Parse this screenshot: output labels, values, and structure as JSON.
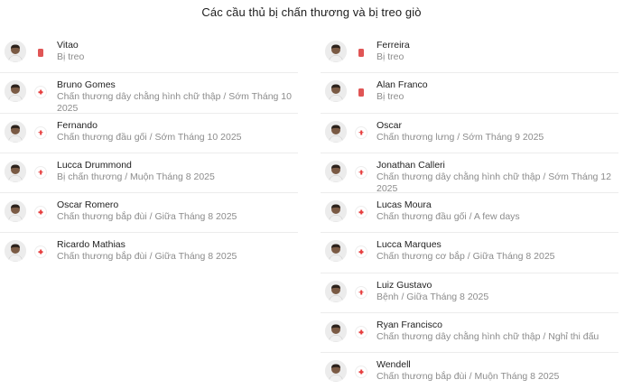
{
  "title": "Các cầu thủ bị chấn thương và bị treo giò",
  "colors": {
    "card": "#e05555",
    "injury_cross": "#e63e3e"
  },
  "left_column": [
    {
      "name": "Vitao",
      "status_icon": "red-card-icon",
      "detail": "Bị treo"
    },
    {
      "name": "Bruno Gomes",
      "status_icon": "injury-cross-icon",
      "detail": "Chấn thương dây chằng hình chữ thập / Sớm Tháng 10 2025"
    },
    {
      "name": "Fernando",
      "status_icon": "injury-cross-icon",
      "detail": "Chấn thương đầu gối / Sớm Tháng 10 2025"
    },
    {
      "name": "Lucca Drummond",
      "status_icon": "injury-cross-icon",
      "detail": "Bị chấn thương / Muộn Tháng 8 2025"
    },
    {
      "name": "Oscar Romero",
      "status_icon": "injury-cross-icon",
      "detail": "Chấn thương bắp đùi / Giữa Tháng 8 2025"
    },
    {
      "name": "Ricardo Mathias",
      "status_icon": "injury-cross-icon",
      "detail": "Chấn thương bắp đùi / Giữa Tháng 8 2025"
    }
  ],
  "right_column": [
    {
      "name": "Ferreira",
      "status_icon": "red-card-icon",
      "detail": "Bị treo"
    },
    {
      "name": "Alan Franco",
      "status_icon": "red-card-icon",
      "detail": "Bị treo"
    },
    {
      "name": "Oscar",
      "status_icon": "injury-cross-icon",
      "detail": "Chấn thương lưng / Sớm Tháng 9 2025"
    },
    {
      "name": "Jonathan Calleri",
      "status_icon": "injury-cross-icon",
      "detail": "Chấn thương dây chằng hình chữ thập / Sớm Tháng 12 2025"
    },
    {
      "name": "Lucas Moura",
      "status_icon": "injury-cross-icon",
      "detail": "Chấn thương đầu gối / A few days"
    },
    {
      "name": "Lucca Marques",
      "status_icon": "injury-cross-icon",
      "detail": "Chấn thương cơ bắp / Giữa Tháng 8 2025"
    },
    {
      "name": "Luiz Gustavo",
      "status_icon": "injury-cross-icon",
      "detail": "Bệnh / Giữa Tháng 8 2025"
    },
    {
      "name": "Ryan Francisco",
      "status_icon": "injury-cross-icon",
      "detail": "Chấn thương dây chằng hình chữ thập / Nghỉ thi đấu"
    },
    {
      "name": "Wendell",
      "status_icon": "injury-cross-icon",
      "detail": "Chấn thương bắp đùi / Muộn Tháng 8 2025"
    }
  ]
}
